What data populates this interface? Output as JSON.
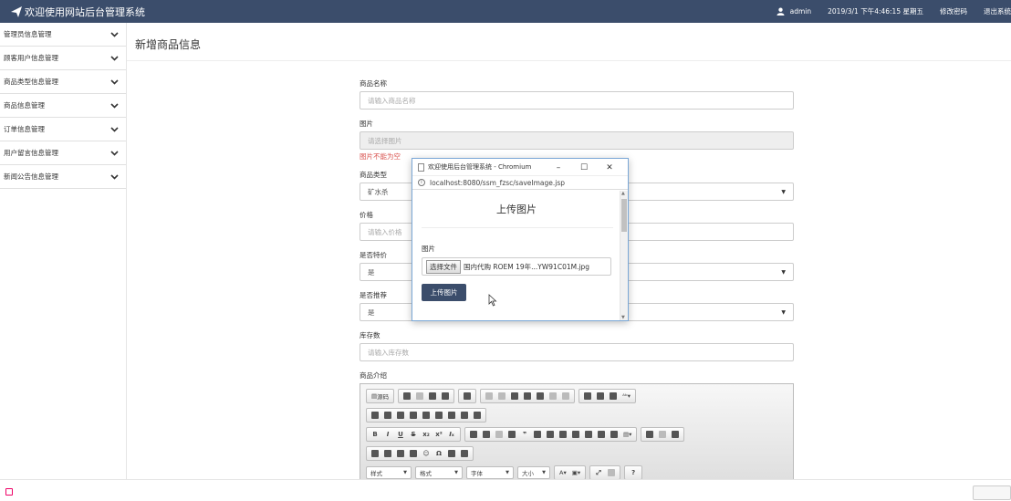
{
  "header": {
    "title": "欢迎使用网站后台管理系统",
    "user": "admin",
    "datetime": "2019/3/1 下午4:46:15 星期五",
    "change_password": "修改密码",
    "logout": "退出系统"
  },
  "sidebar": {
    "items": [
      {
        "label": "管理员信息管理"
      },
      {
        "label": "顾客用户信息管理"
      },
      {
        "label": "商品类型信息管理"
      },
      {
        "label": "商品信息管理"
      },
      {
        "label": "订单信息管理"
      },
      {
        "label": "用户留言信息管理"
      },
      {
        "label": "新闻公告信息管理"
      }
    ]
  },
  "main": {
    "heading": "新增商品信息",
    "form": {
      "name_label": "商品名称",
      "name_placeholder": "请输入商品名称",
      "image_label": "图片",
      "image_placeholder": "请选择图片",
      "image_error": "图片不能为空",
      "type_label": "商品类型",
      "type_value": "矿水杀",
      "price_label": "价格",
      "price_placeholder": "请输入价格",
      "special_label": "是否特价",
      "special_value": "是",
      "recommend_label": "是否推荐",
      "recommend_value": "是",
      "stock_label": "库存数",
      "stock_placeholder": "请输入库存数",
      "intro_label": "商品介绍"
    },
    "editor": {
      "source_label": "源码",
      "more_label": "更多",
      "combo_style": "样式",
      "combo_format": "格式",
      "combo_font": "字体",
      "combo_size": "大小",
      "text_color": "A",
      "help": "?"
    }
  },
  "popup": {
    "window_title": "欢迎使用后台管理系统 - Chromium",
    "url": "localhost:8080/ssm_fzsc/saveImage.jsp",
    "title": "上传图片",
    "field_label": "图片",
    "choose_button": "选择文件",
    "file_name": "国内代购 ROEM 19年...YW91C01M.jpg",
    "upload_button": "上传图片"
  },
  "colors": {
    "header_bg": "#3b4d6b",
    "error": "#d9534f",
    "popup_border": "#7aa7d6"
  }
}
